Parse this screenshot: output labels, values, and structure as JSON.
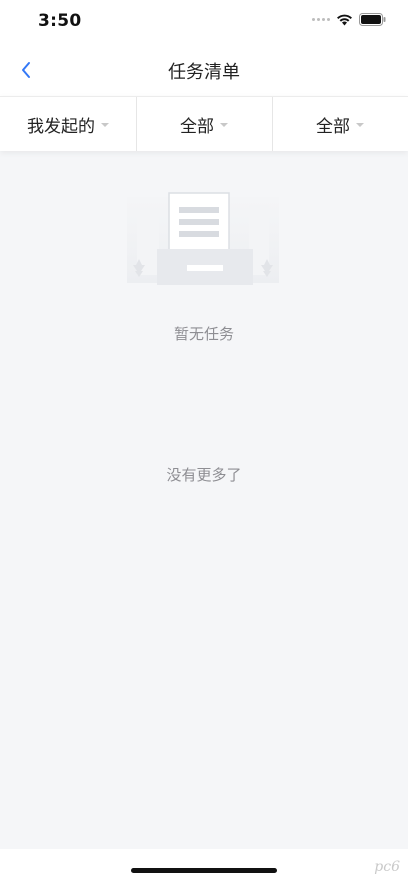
{
  "status_bar": {
    "time": "3:50"
  },
  "nav": {
    "title": "任务清单",
    "back_icon": "chevron-left-icon",
    "accent_color": "#3478f6"
  },
  "filters": [
    {
      "label": "我发起的"
    },
    {
      "label": "全部"
    },
    {
      "label": "全部"
    }
  ],
  "empty_state": {
    "icon": "document-tray-icon",
    "message": "暂无任务"
  },
  "list_footer": {
    "message": "没有更多了"
  },
  "watermark": {
    "text": "pc6"
  }
}
